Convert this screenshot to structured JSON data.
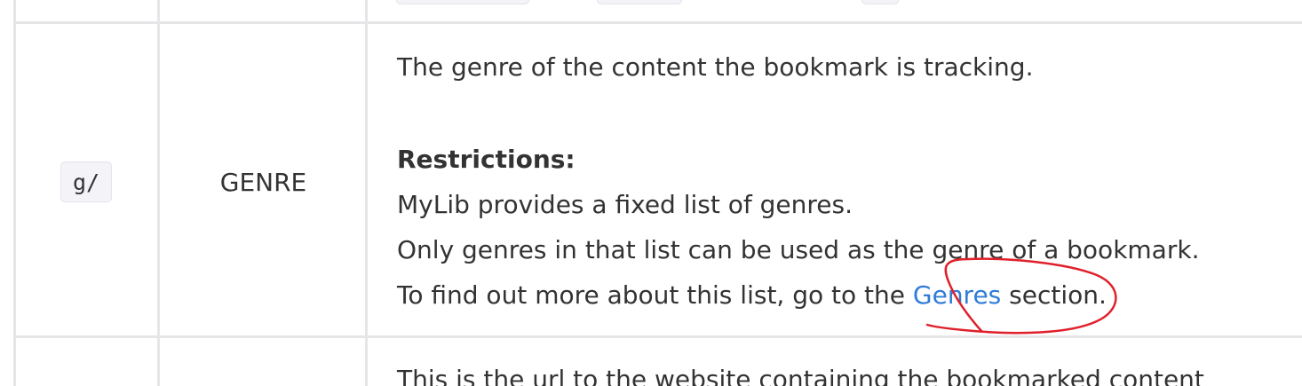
{
  "row": {
    "prefix": "g/",
    "parameter": "GENRE",
    "description": {
      "line1": "The genre of the content the bookmark is tracking.",
      "restrictions_heading": "Restrictions:",
      "line2": "MyLib provides a fixed list of genres.",
      "line3": "Only genres in that list can be used as the genre of a bookmark.",
      "line4_before": "To find out more about this list, go to the ",
      "line4_link": "Genres",
      "line4_after": " section."
    }
  },
  "next_row": {
    "description_partial": "This is the url to the website containing the bookmarked content"
  },
  "colors": {
    "link": "#2f7cd8",
    "annotation": "#e0202a",
    "grid": "#e6e6e9",
    "code_background": "#f3f3f8"
  }
}
